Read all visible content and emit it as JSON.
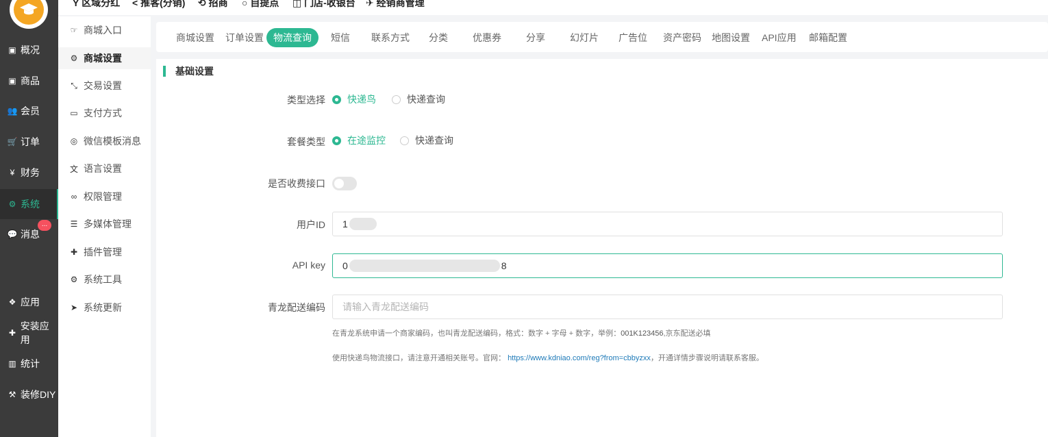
{
  "topnav": {
    "items": [
      "区域分红",
      "推客(分销)",
      "招商",
      "自提点",
      "门店-收银台",
      "经销商管理"
    ]
  },
  "sidebar": {
    "items": [
      {
        "label": "概况",
        "icon": "dashboard-icon"
      },
      {
        "label": "商品",
        "icon": "box-icon"
      },
      {
        "label": "会员",
        "icon": "users-icon"
      },
      {
        "label": "订单",
        "icon": "cart-icon"
      },
      {
        "label": "财务",
        "icon": "yen-icon"
      },
      {
        "label": "系统",
        "icon": "gears-icon"
      },
      {
        "label": "消息",
        "icon": "chat-icon"
      },
      {
        "label": "应用",
        "icon": "cubes-icon"
      },
      {
        "label": "安装应用",
        "icon": "puzzle-icon"
      },
      {
        "label": "统计",
        "icon": "bar-chart-icon"
      },
      {
        "label": "装修DIY",
        "icon": "gavel-icon"
      }
    ],
    "message_badge": "..."
  },
  "subsidebar": {
    "items": [
      {
        "label": "商城入口",
        "icon": "hand-point-icon"
      },
      {
        "label": "商城设置",
        "icon": "gear-icon"
      },
      {
        "label": "交易设置",
        "icon": "compress-icon"
      },
      {
        "label": "支付方式",
        "icon": "credit-card-icon"
      },
      {
        "label": "微信模板消息",
        "icon": "wechat-icon"
      },
      {
        "label": "语言设置",
        "icon": "language-icon"
      },
      {
        "label": "权限管理",
        "icon": "mask-icon"
      },
      {
        "label": "多媒体管理",
        "icon": "list-icon"
      },
      {
        "label": "插件管理",
        "icon": "puzzle-icon"
      },
      {
        "label": "系统工具",
        "icon": "gear-icon"
      },
      {
        "label": "系统更新",
        "icon": "paper-plane-icon"
      }
    ]
  },
  "tabs": [
    "商城设置",
    "订单设置",
    "物流查询",
    "短信",
    "联系方式",
    "分类",
    "优惠券",
    "分享",
    "幻灯片",
    "广告位",
    "资产密码",
    "地图设置",
    "API应用",
    "邮箱配置"
  ],
  "active_tab": "物流查询",
  "form": {
    "section_title": "基础设置",
    "type_label": "类型选择",
    "type_options": [
      "快递鸟",
      "快递查询"
    ],
    "package_label": "套餐类型",
    "package_options": [
      "在途监控",
      "快递查询"
    ],
    "paid_label": "是否收费接口",
    "paid_enabled": false,
    "userid_label": "用户ID",
    "userid_value_start": "1",
    "apikey_label": "API key",
    "apikey_value_start": "0",
    "apikey_value_end": "8",
    "qinglong_label": "青龙配送编码",
    "qinglong_placeholder": "请输入青龙配送编码",
    "hint1_pre": "在青龙系统申请一个商家编码，也叫青龙配送编码，格式：数字 + 字母 + 数字，举例：",
    "hint1_example": "001K123456",
    "hint1_post": ",京东配送必填",
    "hint2_pre": "使用快递鸟物流接口，请注意开通相关账号。官网：",
    "hint2_link": "https://www.kdniao.com/reg?from=cbbyzxx",
    "hint2_post": "，开通详情步骤说明请联系客服。"
  },
  "colors": {
    "accent": "#2db892",
    "sidebar_bg": "#3b3b3b",
    "badge": "#f5515f",
    "link": "#1e7ab8"
  }
}
